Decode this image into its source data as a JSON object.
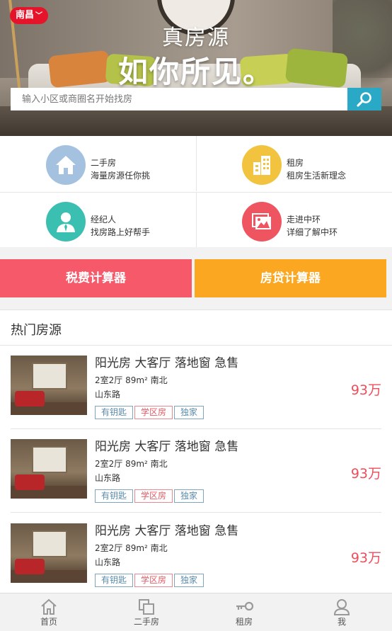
{
  "header": {
    "city": "南昌",
    "slogan_line1": "真房源",
    "slogan_line2": "如你所见。",
    "search_placeholder": "输入小区或商圈名开始找房"
  },
  "services": [
    {
      "title": "二手房",
      "desc": "海量房源任你挑",
      "icon": "house-icon",
      "color": "#a4c2e0"
    },
    {
      "title": "租房",
      "desc": "租房生活新理念",
      "icon": "building-icon",
      "color": "#f1c33f"
    },
    {
      "title": "经纪人",
      "desc": "找房路上好帮手",
      "icon": "agent-icon",
      "color": "#3bbfb0"
    },
    {
      "title": "走进中环",
      "desc": "详细了解中环",
      "icon": "gallery-icon",
      "color": "#ee5561"
    }
  ],
  "calculators": {
    "tax_label": "税费计算器",
    "loan_label": "房贷计算器"
  },
  "hot": {
    "title": "热门房源",
    "listings": [
      {
        "name": "阳光房 大客厅 落地窗 急售",
        "spec": "2室2厅 89m² 南北",
        "road": "山东路",
        "tags": [
          "有钥匙",
          "学区房",
          "独家"
        ],
        "price": "93万"
      },
      {
        "name": "阳光房 大客厅 落地窗 急售",
        "spec": "2室2厅 89m² 南北",
        "road": "山东路",
        "tags": [
          "有钥匙",
          "学区房",
          "独家"
        ],
        "price": "93万"
      },
      {
        "name": "阳光房 大客厅 落地窗 急售",
        "spec": "2室2厅 89m² 南北",
        "road": "山东路",
        "tags": [
          "有钥匙",
          "学区房",
          "独家"
        ],
        "price": "93万"
      }
    ]
  },
  "tabbar": [
    {
      "label": "首页",
      "icon": "home-icon"
    },
    {
      "label": "二手房",
      "icon": "second-hand-icon"
    },
    {
      "label": "租房",
      "icon": "key-icon"
    },
    {
      "label": "我",
      "icon": "user-icon"
    }
  ],
  "colors": {
    "accent_red": "#e5142b",
    "search_button": "#29a9c5",
    "tax_button": "#f5596a",
    "loan_button": "#fba721",
    "price": "#ee4d5a"
  }
}
